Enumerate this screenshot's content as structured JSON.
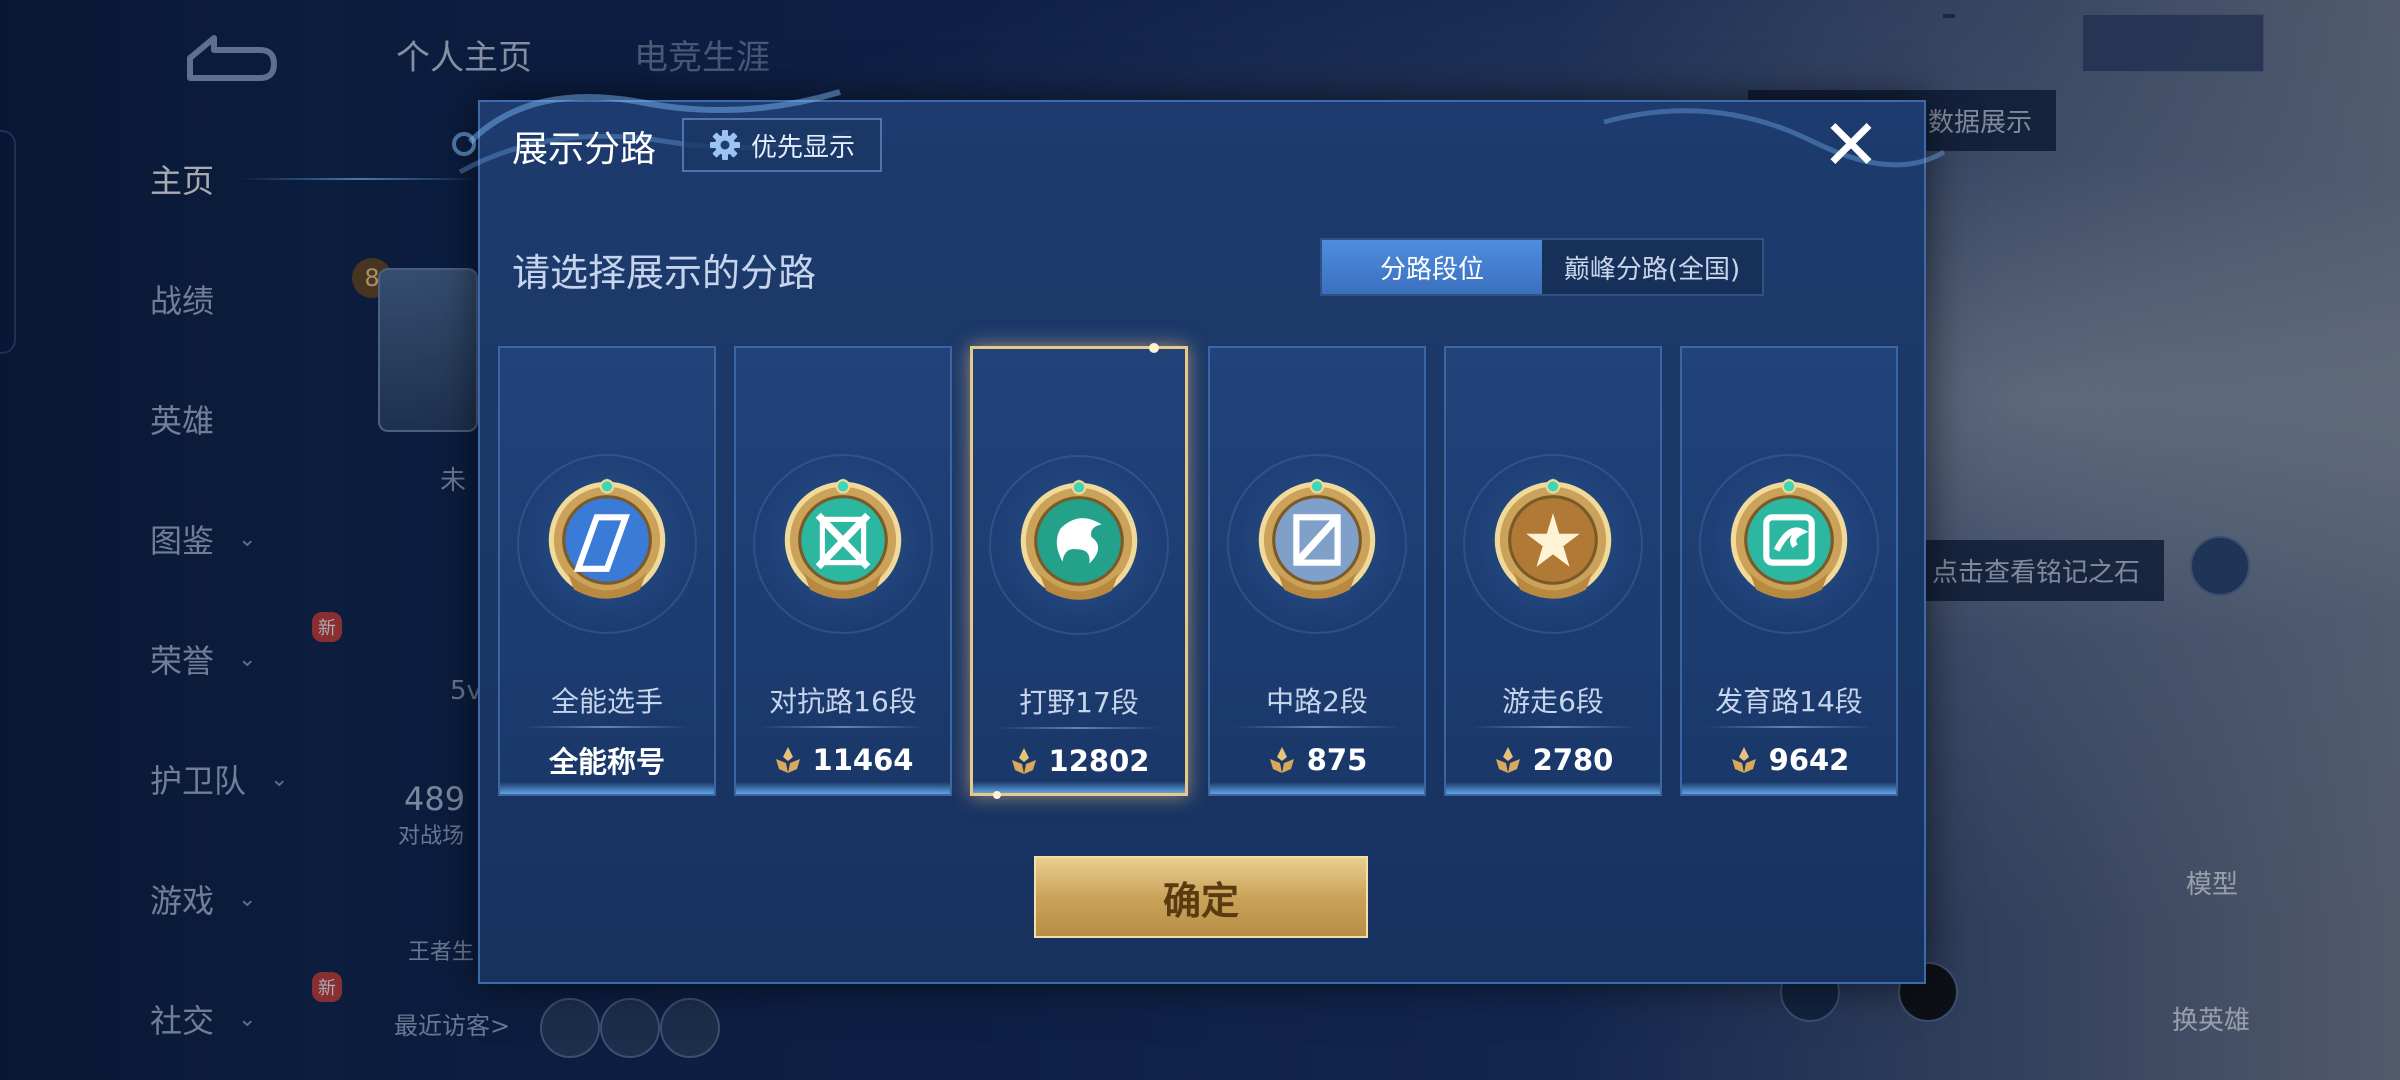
{
  "background": {
    "sidebar_items": [
      {
        "label": "主页",
        "active": true,
        "chevron": false,
        "new": false
      },
      {
        "label": "战绩",
        "active": false,
        "chevron": false,
        "new": false
      },
      {
        "label": "英雄",
        "active": false,
        "chevron": false,
        "new": false
      },
      {
        "label": "图鉴",
        "active": false,
        "chevron": true,
        "new": false
      },
      {
        "label": "荣誉",
        "active": false,
        "chevron": true,
        "new": true
      },
      {
        "label": "护卫队",
        "active": false,
        "chevron": true,
        "new": false
      },
      {
        "label": "游戏",
        "active": false,
        "chevron": true,
        "new": false
      },
      {
        "label": "社交",
        "active": false,
        "chevron": true,
        "new": true
      }
    ],
    "new_badge": "新",
    "tabs": [
      "个人主页",
      "电竞生涯"
    ],
    "level": "8",
    "partial_texts": {
      "count": "489",
      "battle_label": "对战场",
      "king_label": "王者生",
      "fivev": "5v",
      "weiko": "未",
      "recent_visitors": "最近访客>"
    },
    "hints": {
      "switch_hint": "以切换灵宝和数据展示",
      "stone_hint": "点击查看铭记之石"
    },
    "right_buttons": {
      "model": "模型",
      "swap_hero": "换英雄"
    }
  },
  "modal": {
    "title": "展示分路",
    "priority_label": "优先显示",
    "close_icon": "close-icon",
    "prompt": "请选择展示的分路",
    "segments": [
      {
        "label": "分路段位",
        "active": true
      },
      {
        "label": "巅峰分路(全国)",
        "active": false
      }
    ],
    "cards": [
      {
        "lane": "全能选手",
        "value": "全能称号",
        "icon": "all-round-badge-icon",
        "show_points_icon": false,
        "selected": false,
        "badge_color": "#3a7bd8"
      },
      {
        "lane": "对抗路16段",
        "value": "11464",
        "icon": "clash-lane-badge-icon",
        "show_points_icon": true,
        "selected": false,
        "badge_color": "#2bb7a0"
      },
      {
        "lane": "打野17段",
        "value": "12802",
        "icon": "jungle-badge-icon",
        "show_points_icon": true,
        "selected": true,
        "badge_color": "#23a18a"
      },
      {
        "lane": "中路2段",
        "value": "875",
        "icon": "mid-lane-badge-icon",
        "show_points_icon": true,
        "selected": false,
        "badge_color": "#7fa0c9"
      },
      {
        "lane": "游走6段",
        "value": "2780",
        "icon": "roam-badge-icon",
        "show_points_icon": true,
        "selected": false,
        "badge_color": "#b07a36"
      },
      {
        "lane": "发育路14段",
        "value": "9642",
        "icon": "farm-lane-badge-icon",
        "show_points_icon": true,
        "selected": false,
        "badge_color": "#2bb7a0"
      }
    ],
    "confirm_label": "确定"
  }
}
